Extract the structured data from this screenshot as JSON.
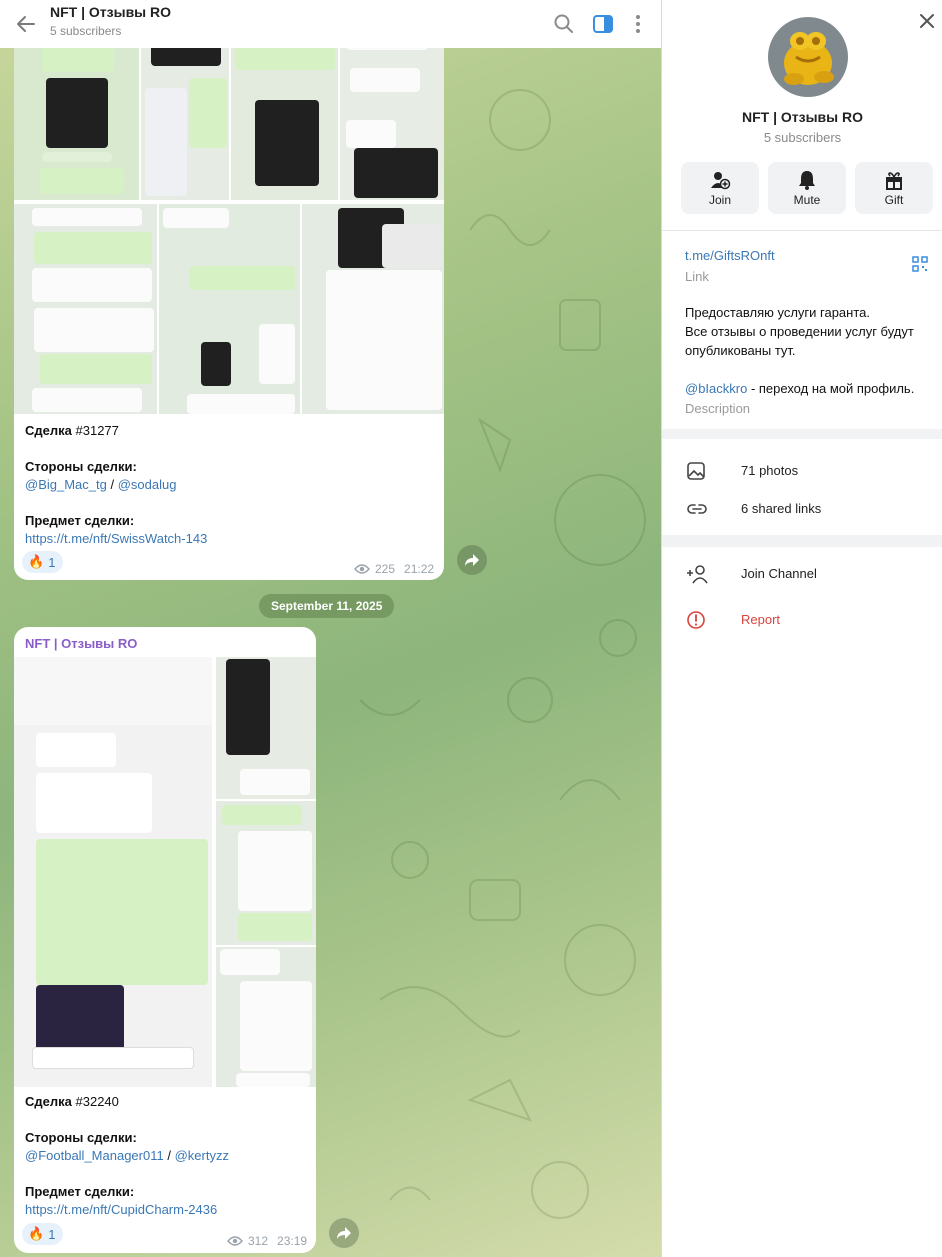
{
  "chat": {
    "title": "NFT | Отзывы RO",
    "subtitle": "5 subscribers",
    "icons": [
      "back-arrow-icon",
      "search-icon",
      "sidebar-toggle-icon",
      "more-vertical-icon"
    ]
  },
  "messages": [
    {
      "deal_label": "Сделка",
      "deal_number": "#31277",
      "parties_label": "Стороны сделки:",
      "party_a": "@Big_Mac_tg",
      "separator": "/",
      "party_b": "@sodalug",
      "item_label": "Предмет сделки:",
      "item_link": "https://t.me/nft/SwissWatch-143",
      "reaction_emoji": "🔥",
      "reaction_count": "1",
      "views": "225",
      "time": "21:22"
    },
    {
      "sender": "NFT | Отзывы RO",
      "deal_label": "Сделка",
      "deal_number": "#32240",
      "parties_label": "Стороны сделки:",
      "party_a": "@Football_Manager011",
      "separator": "/",
      "party_b": "@kertyzz",
      "item_label": "Предмет сделки:",
      "item_link": "https://t.me/nft/CupidCharm-2436",
      "reaction_emoji": "🔥",
      "reaction_count": "1",
      "views": "312",
      "time": "23:19"
    }
  ],
  "date_separator": "September 11, 2025",
  "panel": {
    "name": "NFT | Отзывы RO",
    "subscribers": "5 subscribers",
    "buttons": [
      {
        "label": "Join",
        "icon": "add-user-icon"
      },
      {
        "label": "Mute",
        "icon": "bell-icon"
      },
      {
        "label": "Gift",
        "icon": "gift-icon"
      }
    ],
    "link": "t.me/GiftsROnft",
    "link_label": "Link",
    "description_lines": [
      "Предоставляю услуги гаранта.",
      "Все отзывы о проведении услуг будут опубликованы тут."
    ],
    "profile_handle": "@bIackkro",
    "profile_suffix": " - переход на мой профиль.",
    "description_label": "Description",
    "photos": "71 photos",
    "shared_links": "6 shared links",
    "join_channel": "Join Channel",
    "report": "Report"
  }
}
